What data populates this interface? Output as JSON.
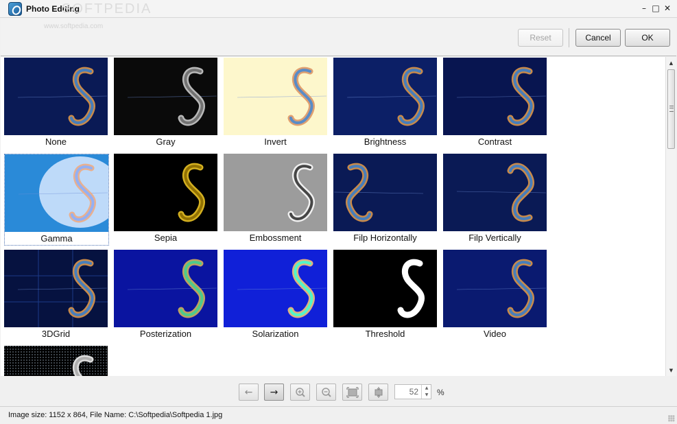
{
  "window": {
    "title": "Photo Editing",
    "watermark": "SOFTPEDIA",
    "watermark_url": "www.softpedia.com",
    "controls": {
      "minimize": "–",
      "maximize": "□",
      "close": "✕"
    }
  },
  "toolbar": {
    "reset_label": "Reset",
    "cancel_label": "Cancel",
    "ok_label": "OK"
  },
  "effects": [
    {
      "label": "None",
      "variant": "none"
    },
    {
      "label": "Gray",
      "variant": "gray"
    },
    {
      "label": "Invert",
      "variant": "invert"
    },
    {
      "label": "Brightness",
      "variant": "brightness"
    },
    {
      "label": "Contrast",
      "variant": "contrast"
    },
    {
      "label": "Gamma",
      "variant": "gamma",
      "selected": true
    },
    {
      "label": "Sepia",
      "variant": "sepia"
    },
    {
      "label": "Embossment",
      "variant": "emboss"
    },
    {
      "label": "Filp Horizontally",
      "variant": "fliph"
    },
    {
      "label": "Filp Vertically",
      "variant": "flipv"
    },
    {
      "label": "3DGrid",
      "variant": "grid"
    },
    {
      "label": "Posterization",
      "variant": "poster"
    },
    {
      "label": "Solarization",
      "variant": "solar"
    },
    {
      "label": "Threshold",
      "variant": "threshold"
    },
    {
      "label": "Video",
      "variant": "video"
    },
    {
      "label": "",
      "variant": "dots"
    }
  ],
  "zoom": {
    "value": "52",
    "unit": "%"
  },
  "status": {
    "text": "Image size: 1152 x 864, File Name: C:\\Softpedia\\Softpedia 1.jpg"
  },
  "colors": {
    "thumb_dark_blue": "#0a1a55",
    "selection_border": "#4a6fb0"
  },
  "icons": {
    "prev": "arrow-left-icon",
    "next": "arrow-right-icon",
    "zoom_in": "zoom-in-icon",
    "zoom_out": "zoom-out-icon",
    "fit": "fit-to-window-icon",
    "actual": "actual-size-icon"
  }
}
